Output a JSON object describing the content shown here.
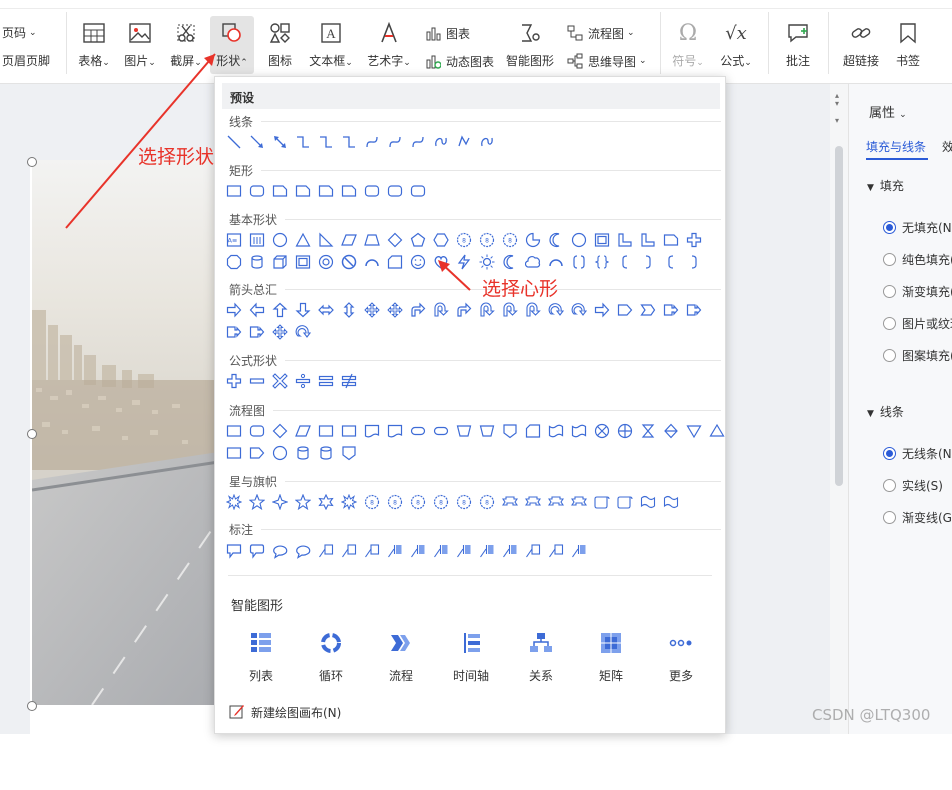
{
  "ribbon": {
    "page_number": "页码",
    "header_footer": "页眉页脚",
    "table": "表格",
    "picture": "图片",
    "screenshot": "截屏",
    "shape": "形状",
    "icon": "图标",
    "textbox": "文本框",
    "wordart": "艺术字",
    "chart": "图表",
    "dynamic_chart": "动态图表",
    "smart_shape": "智能图形",
    "flowchart": "流程图",
    "mindmap": "思维导图",
    "symbol": "符号",
    "formula": "公式",
    "comment": "批注",
    "hyperlink": "超链接",
    "bookmark": "书签"
  },
  "dropdown": {
    "preset": "预设",
    "categories": {
      "lines": "线条",
      "rect": "矩形",
      "basic": "基本形状",
      "arrows": "箭头总汇",
      "formula": "公式形状",
      "flowchart": "流程图",
      "stars": "星与旗帜",
      "callouts": "标注"
    },
    "smart_title": "智能图形",
    "smart_items": [
      "列表",
      "循环",
      "流程",
      "时间轴",
      "关系",
      "矩阵",
      "更多"
    ],
    "new_canvas": "新建绘图画布(N)"
  },
  "panel": {
    "title": "属性",
    "tab_active": "填充与线条",
    "tab_other": "效",
    "fill_section": "填充",
    "fill_options": [
      "无填充(N)",
      "纯色填充(",
      "渐变填充(",
      "图片或纹理",
      "图案填充("
    ],
    "line_section": "线条",
    "line_options": [
      "无线条(N)",
      "实线(S)",
      "渐变线(G)"
    ]
  },
  "annotations": {
    "select_shape": "选择形状",
    "select_heart": "选择心形"
  },
  "watermark": "CSDN @LTQ300",
  "colors": {
    "accent": "#2b5bd7",
    "annotation": "#e8332a",
    "shape_stroke": "#3d6bd6"
  }
}
